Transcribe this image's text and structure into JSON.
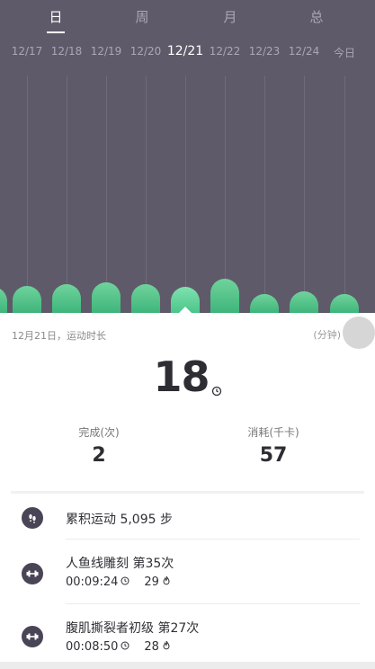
{
  "tabs": [
    {
      "label": "日",
      "active": true
    },
    {
      "label": "周",
      "active": false
    },
    {
      "label": "月",
      "active": false
    },
    {
      "label": "总",
      "active": false
    }
  ],
  "dates": [
    {
      "label": "12/17",
      "active": false
    },
    {
      "label": "12/18",
      "active": false
    },
    {
      "label": "12/19",
      "active": false
    },
    {
      "label": "12/20",
      "active": false
    },
    {
      "label": "12/21",
      "active": true
    },
    {
      "label": "12/22",
      "active": false
    },
    {
      "label": "12/23",
      "active": false
    },
    {
      "label": "12/24",
      "active": false
    },
    {
      "label": "今日",
      "active": false
    }
  ],
  "bar_values_minutes": [
    18,
    19,
    20,
    21,
    20,
    18,
    24,
    13,
    15,
    13
  ],
  "colors": {
    "header_bg": "#5f5a69",
    "bar": "#4cc48a",
    "text_dark": "#2d2d33"
  },
  "summary": {
    "caption": "12月21日，运动时长",
    "unit": "(分钟)",
    "duration_value": "18",
    "completed_label": "完成(次)",
    "completed_value": "2",
    "calories_label": "消耗(千卡)",
    "calories_value": "57"
  },
  "activities": {
    "steps": {
      "icon": "footprints-icon",
      "label": "累积运动 5,095 步"
    },
    "workout1": {
      "icon": "dumbbell-icon",
      "title": "人鱼线雕刻  第35次",
      "time": "00:09:24",
      "calories": "29"
    },
    "workout2": {
      "icon": "dumbbell-icon",
      "title": "腹肌撕裂者初级  第27次",
      "time": "00:08:50",
      "calories": "28"
    }
  }
}
